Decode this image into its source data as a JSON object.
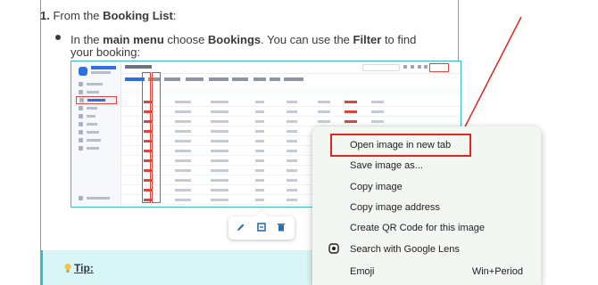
{
  "doc": {
    "step_number": "1.",
    "step_prefix": " From the ",
    "step_bold": "Booking List",
    "step_suffix": ":",
    "bullet_prefix": "In the ",
    "bullet_bold1": "main menu",
    "bullet_mid": " choose ",
    "bullet_bold2": "Bookings",
    "bullet_mid2": ". You can use the ",
    "bullet_bold3": "Filter",
    "bullet_suffix": " to find your booking:",
    "tip_label": "Tip:"
  },
  "image_toolbar": {
    "edit_icon": "pencil-icon",
    "replace_icon": "swap-icon",
    "delete_icon": "trash-icon"
  },
  "context_menu": {
    "items": [
      {
        "label": "Open image in new tab",
        "shortcut": ""
      },
      {
        "label": "Save image as...",
        "shortcut": ""
      },
      {
        "label": "Copy image",
        "shortcut": ""
      },
      {
        "label": "Copy image address",
        "shortcut": ""
      },
      {
        "label": "Create QR Code for this image",
        "shortcut": ""
      },
      {
        "label": "Search with Google Lens",
        "shortcut": ""
      },
      {
        "label": "Emoji",
        "shortcut": "Win+Period"
      }
    ],
    "highlight_color": "#e0261f"
  },
  "colors": {
    "accent": "#39bdc4",
    "annotation": "#e0261f",
    "tip_bg": "#d9f6f6"
  }
}
